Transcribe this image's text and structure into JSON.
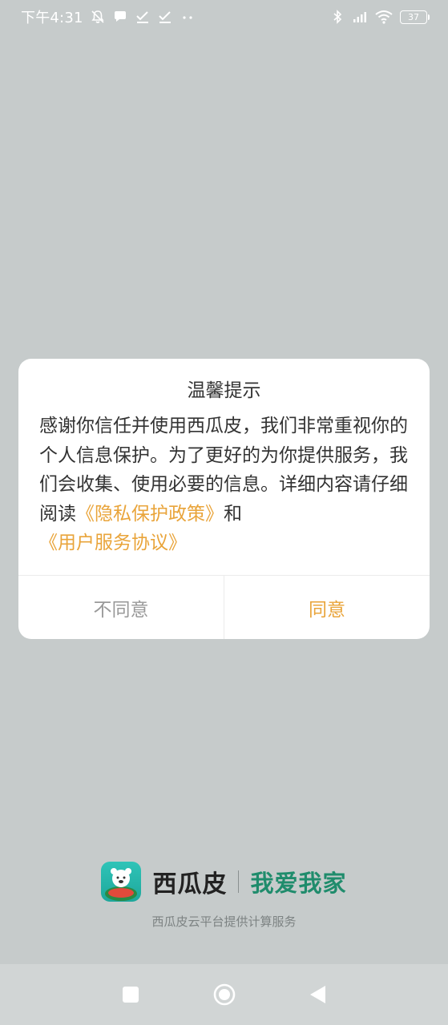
{
  "status_bar": {
    "time": "下午4:31",
    "battery": "37",
    "icons": [
      "mute-bell-icon",
      "chat-bubble-icon",
      "check-icon",
      "check-icon",
      "more-dots-icon",
      "bluetooth-icon",
      "signal-icon",
      "wifi-icon",
      "battery-icon"
    ]
  },
  "dialog": {
    "title": "温馨提示",
    "body_text": "感谢你信任并使用西瓜皮，我们非常重视你的个人信息保护。为了更好的为你提供服务，我们会收集、使用必要的信息。详细内容请仔细阅读",
    "privacy_link": "《隐私保护政策》",
    "and_text": "和",
    "terms_link": "《用户服务协议》",
    "disagree_label": "不同意",
    "agree_label": "同意"
  },
  "brand": {
    "name": "西瓜皮",
    "slogan": "我爱我家",
    "subtitle": "西瓜皮云平台提供计算服务"
  },
  "colors": {
    "background": "#c6cbcb",
    "accent": "#e9a43a",
    "slogan": "#1f8c6c"
  }
}
